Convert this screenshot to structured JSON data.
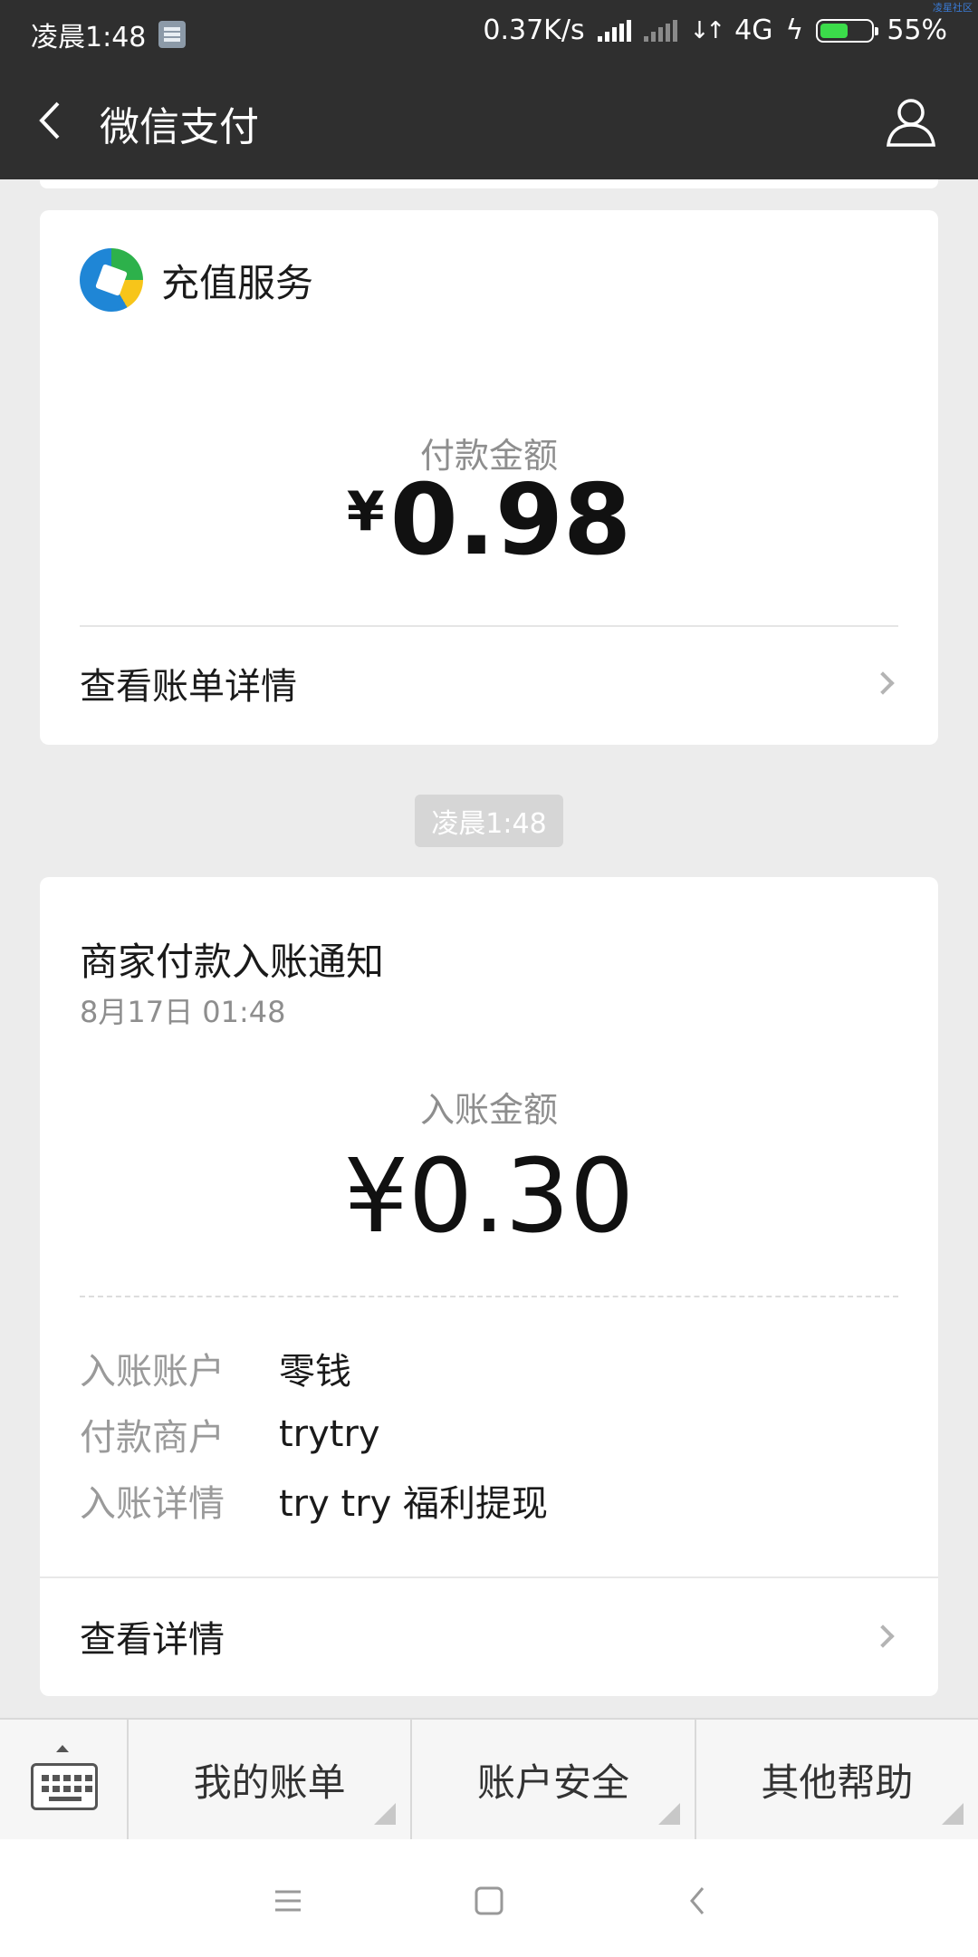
{
  "status_bar": {
    "time": "凌晨1:48",
    "net_speed": "0.37K/s",
    "network": "4G",
    "battery_percent": "55%",
    "battery_level": 0.55
  },
  "watermark": "凌星社区",
  "header": {
    "title": "微信支付"
  },
  "card_payment": {
    "service_name": "充值服务",
    "amount_label": "付款金额",
    "currency": "¥",
    "amount": "0.98",
    "link_label": "查看账单详情"
  },
  "timestamp_chip": "凌晨1:48",
  "card_notice": {
    "title": "商家付款入账通知",
    "date": "8月17日  01:48",
    "amount_label": "入账金额",
    "amount": "¥0.30",
    "details": [
      {
        "key": "入账账户",
        "value": "零钱"
      },
      {
        "key": "付款商户",
        "value": "trytry"
      },
      {
        "key": "入账详情",
        "value": "try try 福利提现"
      }
    ],
    "link_label": "查看详情"
  },
  "menu": {
    "items": [
      {
        "label": "我的账单"
      },
      {
        "label": "账户安全"
      },
      {
        "label": "其他帮助"
      }
    ]
  },
  "colors": {
    "header_bg": "#2f2f2f",
    "page_bg": "#ececec",
    "battery_green": "#3bdc4a"
  }
}
